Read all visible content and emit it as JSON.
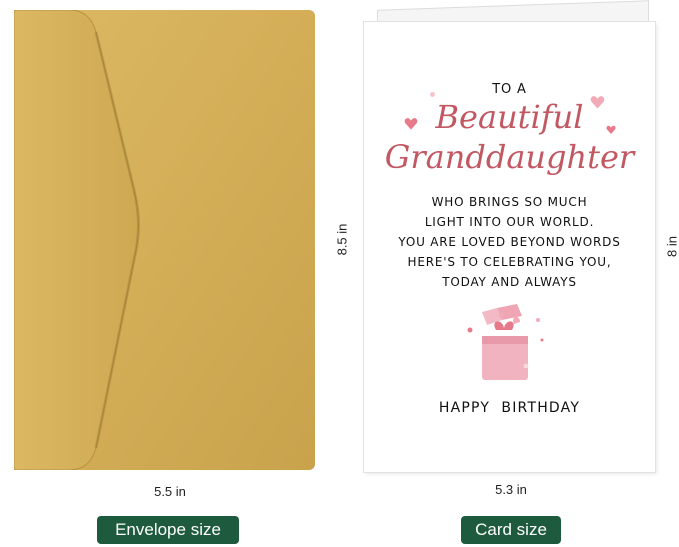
{
  "dimensions": {
    "envelope_height": "8.5 in",
    "envelope_width": "5.5 in",
    "card_height": "8 in",
    "card_width": "5.3 in"
  },
  "card": {
    "intro": "TO A",
    "script_line1": "Beautiful",
    "script_line2": "Granddaughter",
    "message_lines": [
      "WHO BRINGS SO MUCH",
      "LIGHT INTO OUR WORLD.",
      "YOU ARE LOVED BEYOND WORDS",
      "HERE'S TO CELEBRATING YOU,",
      "TODAY AND ALWAYS"
    ],
    "closing": "HAPPY  BIRTHDAY"
  },
  "labels": {
    "envelope": "Envelope size",
    "card": "Card size"
  },
  "colors": {
    "envelope_gold": "#d6b15b",
    "script_pink": "#c25862",
    "label_green": "#1e5b3e",
    "gift_pink": "#f2b3c0"
  },
  "icons": [
    "heart-icon",
    "gift-box-illustration"
  ]
}
